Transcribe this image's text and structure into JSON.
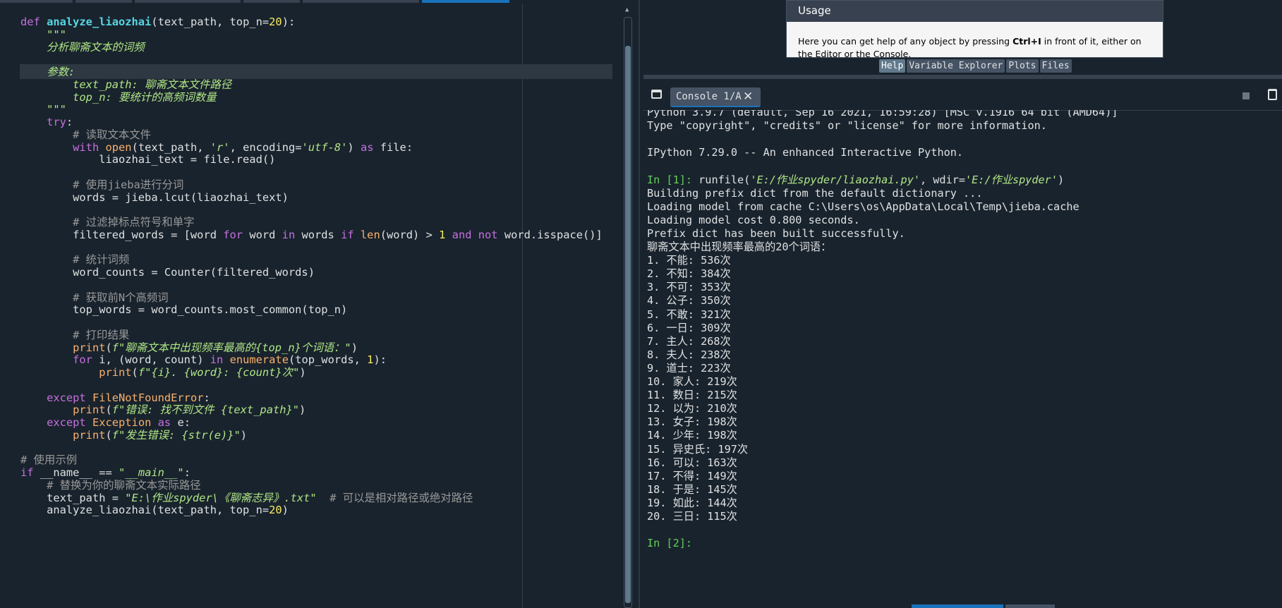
{
  "editor": {
    "code": [
      {
        "parts": [
          {
            "c": "kw",
            "t": "def "
          },
          {
            "c": "fn",
            "t": "analyze_liaozhai"
          },
          {
            "c": "",
            "t": "(text_path, top_n="
          },
          {
            "c": "num",
            "t": "20"
          },
          {
            "c": "",
            "t": "):"
          }
        ]
      },
      {
        "parts": [
          {
            "c": "doc",
            "t": "    \"\"\""
          }
        ]
      },
      {
        "parts": [
          {
            "c": "doc",
            "t": "    分析聊斋文本的词频"
          }
        ]
      },
      {
        "parts": [
          {
            "c": "",
            "t": ""
          }
        ]
      },
      {
        "parts": [
          {
            "c": "doc",
            "t": "    参数:"
          }
        ],
        "highlight": true
      },
      {
        "parts": [
          {
            "c": "doc",
            "t": "        text_path: 聊斋文本文件路径"
          }
        ]
      },
      {
        "parts": [
          {
            "c": "doc",
            "t": "        top_n: 要统计的高频词数量"
          }
        ]
      },
      {
        "parts": [
          {
            "c": "doc",
            "t": "    \"\"\""
          }
        ]
      },
      {
        "parts": [
          {
            "c": "",
            "t": "    "
          },
          {
            "c": "kw",
            "t": "try"
          },
          {
            "c": "",
            "t": ":"
          }
        ]
      },
      {
        "parts": [
          {
            "c": "cmt",
            "t": "        # 读取文本文件"
          }
        ]
      },
      {
        "parts": [
          {
            "c": "",
            "t": "        "
          },
          {
            "c": "kw",
            "t": "with "
          },
          {
            "c": "bi",
            "t": "open"
          },
          {
            "c": "",
            "t": "(text_path, "
          },
          {
            "c": "doc",
            "t": "'r'"
          },
          {
            "c": "",
            "t": ", encoding="
          },
          {
            "c": "doc",
            "t": "'utf-8'"
          },
          {
            "c": "",
            "t": ") "
          },
          {
            "c": "kw",
            "t": "as"
          },
          {
            "c": "",
            "t": " file:"
          }
        ]
      },
      {
        "parts": [
          {
            "c": "",
            "t": "            liaozhai_text = file.read()"
          }
        ]
      },
      {
        "parts": [
          {
            "c": "",
            "t": ""
          }
        ]
      },
      {
        "parts": [
          {
            "c": "cmt",
            "t": "        # 使用jieba进行分词"
          }
        ]
      },
      {
        "parts": [
          {
            "c": "",
            "t": "        words = jieba.lcut(liaozhai_text)"
          }
        ]
      },
      {
        "parts": [
          {
            "c": "",
            "t": ""
          }
        ]
      },
      {
        "parts": [
          {
            "c": "cmt",
            "t": "        # 过滤掉标点符号和单字"
          }
        ]
      },
      {
        "parts": [
          {
            "c": "",
            "t": "        filtered_words = [word "
          },
          {
            "c": "kw",
            "t": "for"
          },
          {
            "c": "",
            "t": " word "
          },
          {
            "c": "kw",
            "t": "in"
          },
          {
            "c": "",
            "t": " words "
          },
          {
            "c": "kw",
            "t": "if "
          },
          {
            "c": "bi",
            "t": "len"
          },
          {
            "c": "",
            "t": "(word) > "
          },
          {
            "c": "num",
            "t": "1"
          },
          {
            "c": "kw",
            "t": " and not"
          },
          {
            "c": "",
            "t": " word.isspace()]"
          }
        ]
      },
      {
        "parts": [
          {
            "c": "",
            "t": ""
          }
        ]
      },
      {
        "parts": [
          {
            "c": "cmt",
            "t": "        # 统计词频"
          }
        ]
      },
      {
        "parts": [
          {
            "c": "",
            "t": "        word_counts = Counter(filtered_words)"
          }
        ]
      },
      {
        "parts": [
          {
            "c": "",
            "t": ""
          }
        ]
      },
      {
        "parts": [
          {
            "c": "cmt",
            "t": "        # 获取前N个高频词"
          }
        ]
      },
      {
        "parts": [
          {
            "c": "",
            "t": "        top_words = word_counts.most_common(top_n)"
          }
        ]
      },
      {
        "parts": [
          {
            "c": "",
            "t": ""
          }
        ]
      },
      {
        "parts": [
          {
            "c": "cmt",
            "t": "        # 打印结果"
          }
        ]
      },
      {
        "parts": [
          {
            "c": "",
            "t": "        "
          },
          {
            "c": "bi",
            "t": "print"
          },
          {
            "c": "",
            "t": "("
          },
          {
            "c": "doc",
            "t": "f\"聊斋文本中出现频率最高的{top_n}个词语：\""
          },
          {
            "c": "",
            "t": ")"
          }
        ]
      },
      {
        "parts": [
          {
            "c": "",
            "t": "        "
          },
          {
            "c": "kw",
            "t": "for"
          },
          {
            "c": "",
            "t": " i, (word, count) "
          },
          {
            "c": "kw",
            "t": "in "
          },
          {
            "c": "bi",
            "t": "enumerate"
          },
          {
            "c": "",
            "t": "(top_words, "
          },
          {
            "c": "num",
            "t": "1"
          },
          {
            "c": "",
            "t": "):"
          }
        ]
      },
      {
        "parts": [
          {
            "c": "",
            "t": "            "
          },
          {
            "c": "bi",
            "t": "print"
          },
          {
            "c": "",
            "t": "("
          },
          {
            "c": "doc",
            "t": "f\"{i}. {word}: {count}次\""
          },
          {
            "c": "",
            "t": ")"
          }
        ]
      },
      {
        "parts": [
          {
            "c": "",
            "t": ""
          }
        ]
      },
      {
        "parts": [
          {
            "c": "",
            "t": "    "
          },
          {
            "c": "kw",
            "t": "except "
          },
          {
            "c": "bi",
            "t": "FileNotFoundError"
          },
          {
            "c": "",
            "t": ":"
          }
        ]
      },
      {
        "parts": [
          {
            "c": "",
            "t": "        "
          },
          {
            "c": "bi",
            "t": "print"
          },
          {
            "c": "",
            "t": "("
          },
          {
            "c": "doc",
            "t": "f\"错误: 找不到文件 {text_path}\""
          },
          {
            "c": "",
            "t": ")"
          }
        ]
      },
      {
        "parts": [
          {
            "c": "",
            "t": "    "
          },
          {
            "c": "kw",
            "t": "except "
          },
          {
            "c": "bi",
            "t": "Exception"
          },
          {
            "c": "kw",
            "t": " as"
          },
          {
            "c": "",
            "t": " e:"
          }
        ]
      },
      {
        "parts": [
          {
            "c": "",
            "t": "        "
          },
          {
            "c": "bi",
            "t": "print"
          },
          {
            "c": "",
            "t": "("
          },
          {
            "c": "doc",
            "t": "f\"发生错误: {str(e)}\""
          },
          {
            "c": "",
            "t": ")"
          }
        ]
      },
      {
        "parts": [
          {
            "c": "",
            "t": ""
          }
        ]
      },
      {
        "parts": [
          {
            "c": "cmt",
            "t": "# 使用示例"
          }
        ]
      },
      {
        "parts": [
          {
            "c": "kw",
            "t": "if"
          },
          {
            "c": "",
            "t": " __name__ == "
          },
          {
            "c": "doc",
            "t": "\"__main__\""
          },
          {
            "c": "",
            "t": ":"
          }
        ]
      },
      {
        "parts": [
          {
            "c": "cmt",
            "t": "    # 替换为你的聊斋文本实际路径"
          }
        ]
      },
      {
        "parts": [
          {
            "c": "",
            "t": "    text_path = "
          },
          {
            "c": "doc",
            "t": "\"E:\\作业spyder\\《聊斋志异》.txt\""
          },
          {
            "c": "cmt",
            "t": "  # 可以是相对路径或绝对路径"
          }
        ]
      },
      {
        "parts": [
          {
            "c": "",
            "t": "    analyze_liaozhai(text_path, top_n="
          },
          {
            "c": "num",
            "t": "20"
          },
          {
            "c": "",
            "t": ")"
          }
        ]
      }
    ]
  },
  "help": {
    "usage_title": "Usage",
    "usage_text_1": "Here you can get help of any object by pressing ",
    "usage_shortcut": "Ctrl+I",
    "usage_text_2": " in front of it, either on the Editor or the Console.",
    "tabs": [
      "Help",
      "Variable Explorer",
      "Plots",
      "Files"
    ],
    "active_tab": "Help"
  },
  "console": {
    "tab_label": "Console 1/A",
    "lines": [
      {
        "parts": [
          {
            "c": "",
            "t": "Python 3.9.7 (default, Sep 16 2021, 16:59:28) [MSC v.1916 64 bit (AMD64)]"
          }
        ]
      },
      {
        "parts": [
          {
            "c": "",
            "t": "Type \"copyright\", \"credits\" or \"license\" for more information."
          }
        ]
      },
      {
        "parts": [
          {
            "c": "",
            "t": ""
          }
        ]
      },
      {
        "parts": [
          {
            "c": "",
            "t": "IPython 7.29.0 -- An enhanced Interactive Python."
          }
        ]
      },
      {
        "parts": [
          {
            "c": "",
            "t": ""
          }
        ]
      },
      {
        "parts": [
          {
            "c": "prompt",
            "t": "In [1]: "
          },
          {
            "c": "",
            "t": "runfile("
          },
          {
            "c": "cstr",
            "t": "'E:/作业spyder/liaozhai.py'"
          },
          {
            "c": "",
            "t": ", wdir="
          },
          {
            "c": "cstr",
            "t": "'E:/作业spyder'"
          },
          {
            "c": "",
            "t": ")"
          }
        ]
      },
      {
        "parts": [
          {
            "c": "",
            "t": "Building prefix dict from the default dictionary ..."
          }
        ]
      },
      {
        "parts": [
          {
            "c": "",
            "t": "Loading model from cache C:\\Users\\os\\AppData\\Local\\Temp\\jieba.cache"
          }
        ]
      },
      {
        "parts": [
          {
            "c": "",
            "t": "Loading model cost 0.800 seconds."
          }
        ]
      },
      {
        "parts": [
          {
            "c": "",
            "t": "Prefix dict has been built successfully."
          }
        ]
      },
      {
        "parts": [
          {
            "c": "",
            "t": "聊斋文本中出现频率最高的20个词语："
          }
        ]
      },
      {
        "parts": [
          {
            "c": "",
            "t": "1. 不能: 536次"
          }
        ]
      },
      {
        "parts": [
          {
            "c": "",
            "t": "2. 不知: 384次"
          }
        ]
      },
      {
        "parts": [
          {
            "c": "",
            "t": "3. 不可: 353次"
          }
        ]
      },
      {
        "parts": [
          {
            "c": "",
            "t": "4. 公子: 350次"
          }
        ]
      },
      {
        "parts": [
          {
            "c": "",
            "t": "5. 不敢: 321次"
          }
        ]
      },
      {
        "parts": [
          {
            "c": "",
            "t": "6. 一日: 309次"
          }
        ]
      },
      {
        "parts": [
          {
            "c": "",
            "t": "7. 主人: 268次"
          }
        ]
      },
      {
        "parts": [
          {
            "c": "",
            "t": "8. 夫人: 238次"
          }
        ]
      },
      {
        "parts": [
          {
            "c": "",
            "t": "9. 道士: 223次"
          }
        ]
      },
      {
        "parts": [
          {
            "c": "",
            "t": "10. 家人: 219次"
          }
        ]
      },
      {
        "parts": [
          {
            "c": "",
            "t": "11. 数日: 215次"
          }
        ]
      },
      {
        "parts": [
          {
            "c": "",
            "t": "12. 以为: 210次"
          }
        ]
      },
      {
        "parts": [
          {
            "c": "",
            "t": "13. 女子: 198次"
          }
        ]
      },
      {
        "parts": [
          {
            "c": "",
            "t": "14. 少年: 198次"
          }
        ]
      },
      {
        "parts": [
          {
            "c": "",
            "t": "15. 异史氏: 197次"
          }
        ]
      },
      {
        "parts": [
          {
            "c": "",
            "t": "16. 可以: 163次"
          }
        ]
      },
      {
        "parts": [
          {
            "c": "",
            "t": "17. 不得: 149次"
          }
        ]
      },
      {
        "parts": [
          {
            "c": "",
            "t": "18. 于是: 145次"
          }
        ]
      },
      {
        "parts": [
          {
            "c": "",
            "t": "19. 如此: 144次"
          }
        ]
      },
      {
        "parts": [
          {
            "c": "",
            "t": "20. 三日: 115次"
          }
        ]
      },
      {
        "parts": [
          {
            "c": "",
            "t": ""
          }
        ]
      },
      {
        "parts": [
          {
            "c": "prompt",
            "t": "In [2]: "
          }
        ]
      }
    ]
  },
  "icons": {
    "browse_tabs": "browse-tabs-icon",
    "close_tab": "close-icon",
    "stop": "stop-icon",
    "clear": "trash-icon"
  },
  "colors": {
    "background": "#19232d",
    "keyword": "#c670e0",
    "function": "#57d6e4",
    "number": "#faed5c",
    "string": "#b0e686",
    "comment": "#999999",
    "builtin": "#fab16c",
    "prompt": "#63d05a",
    "accent": "#1a72bb"
  }
}
